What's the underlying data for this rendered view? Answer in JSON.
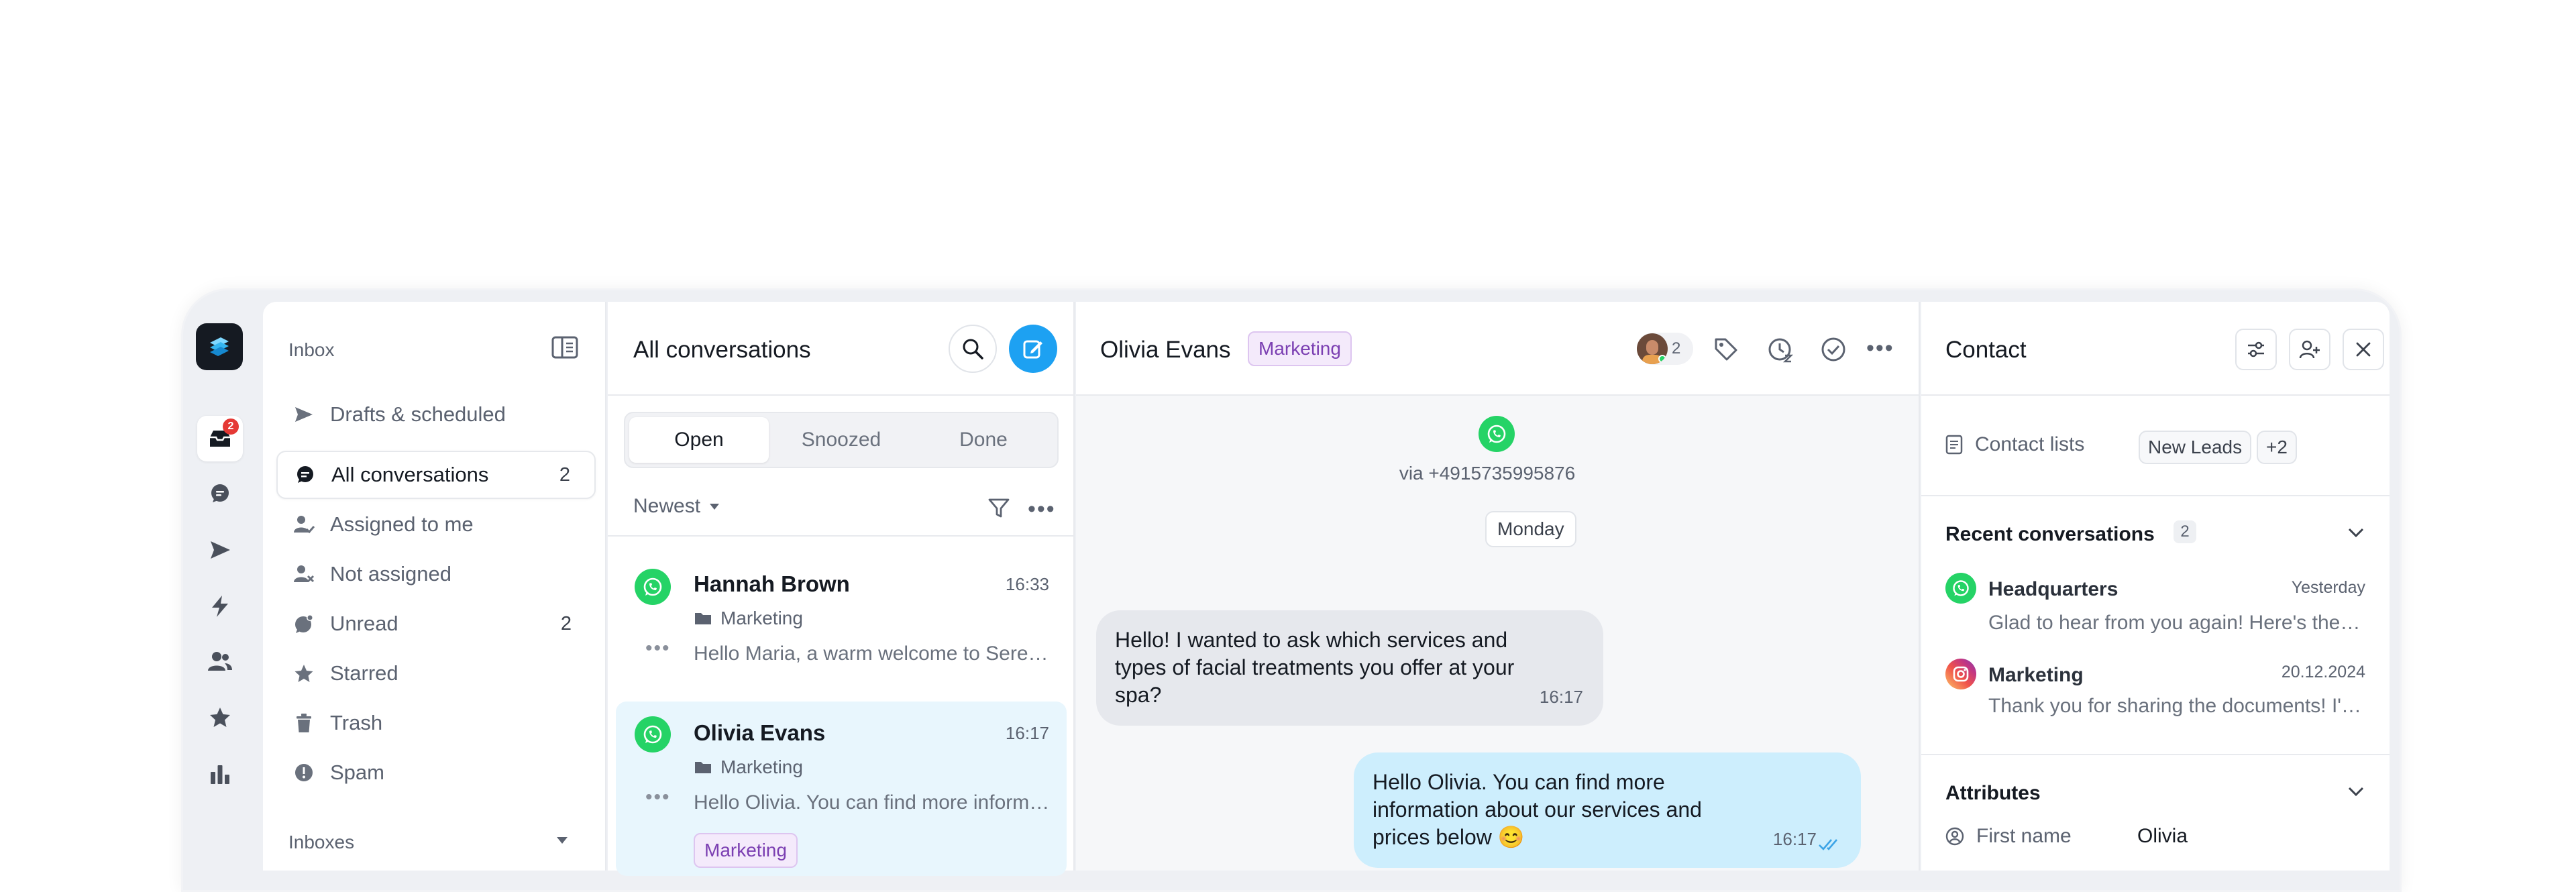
{
  "rail": {
    "inbox_badge": "2"
  },
  "inbox_panel": {
    "title": "Inbox",
    "items": [
      {
        "label": "Drafts & scheduled",
        "count": ""
      },
      {
        "label": "All conversations",
        "count": "2"
      },
      {
        "label": "Assigned to me",
        "count": ""
      },
      {
        "label": "Not assigned",
        "count": ""
      },
      {
        "label": "Unread",
        "count": "2"
      },
      {
        "label": "Starred",
        "count": ""
      },
      {
        "label": "Trash",
        "count": ""
      },
      {
        "label": "Spam",
        "count": ""
      }
    ],
    "inboxes_label": "Inboxes"
  },
  "list_panel": {
    "title": "All conversations",
    "tabs": [
      "Open",
      "Snoozed",
      "Done"
    ],
    "active_tab": "Open",
    "sort_label": "Newest",
    "conversations": [
      {
        "name": "Hannah Brown",
        "time": "16:33",
        "folder": "Marketing",
        "preview": "Hello Maria, a warm welcome to Serenity Spa"
      },
      {
        "name": "Olivia Evans",
        "time": "16:17",
        "folder": "Marketing",
        "preview": "Hello Olivia. You can find more information about our services",
        "tag": "Marketing"
      }
    ]
  },
  "chat_panel": {
    "contact_name": "Olivia Evans",
    "tag": "Marketing",
    "assignee_count": "2",
    "channel_text": "via +4915735995876",
    "day_divider": "Monday",
    "messages": [
      {
        "direction": "in",
        "text": "Hello! I wanted to ask which services and types of facial treatments you offer at your spa?",
        "time": "16:17"
      },
      {
        "direction": "out",
        "text": "Hello Olivia. You can find more information about our services and prices below 😊",
        "time": "16:17"
      }
    ]
  },
  "contact_panel": {
    "title": "Contact",
    "contact_lists_label": "Contact lists",
    "contact_list_chip": "New Leads",
    "contact_list_more": "+2",
    "recent_title": "Recent conversations",
    "recent_count": "2",
    "recent": [
      {
        "name": "Headquarters",
        "date": "Yesterday",
        "preview": "Glad to hear from you again! Here's the info you requested",
        "channel": "whatsapp"
      },
      {
        "name": "Marketing",
        "date": "20.12.2024",
        "preview": "Thank you for sharing the documents! I'll review them",
        "channel": "instagram"
      }
    ],
    "attributes_title": "Attributes",
    "attributes": [
      {
        "label": "First name",
        "value": "Olivia"
      }
    ]
  },
  "colors": {
    "accent": "#1da1f2",
    "whatsapp": "#25d366",
    "badge": "#e53935",
    "tag_purple": "#7b3fb2"
  }
}
